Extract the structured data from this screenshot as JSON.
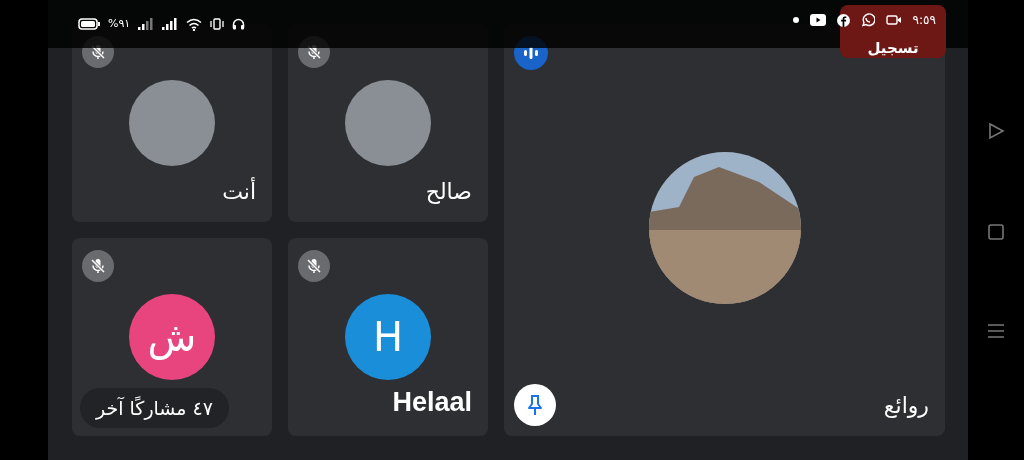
{
  "status_bar": {
    "battery_text": "%٩١",
    "time": "٩:٥٩"
  },
  "recording_badge": {
    "label": "تسجيل"
  },
  "tiles": [
    {
      "name": "صالح",
      "avatar": {
        "kind": "photo"
      },
      "muted": true
    },
    {
      "name": "أنت",
      "avatar": {
        "kind": "photo"
      },
      "muted": true
    },
    {
      "name": "Helaal",
      "avatar": {
        "kind": "letter",
        "letter": "H",
        "color": "#1a8ed8"
      },
      "muted": true
    },
    {
      "avatar": {
        "kind": "letter",
        "letter": "ش",
        "color": "#e8457f"
      },
      "muted": true,
      "overflow_label": "٤٧ مشاركًا آخر"
    }
  ],
  "main_tile": {
    "name": "روائع",
    "avatar": {
      "kind": "landscape"
    },
    "speaking": true,
    "pinned": true
  }
}
